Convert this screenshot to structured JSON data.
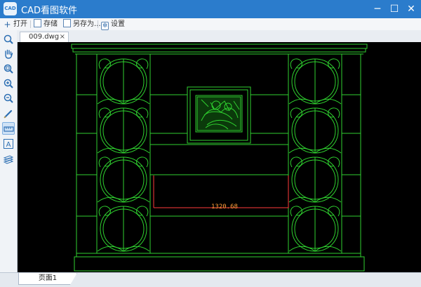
{
  "app": {
    "logo_text": "CAD",
    "title": "CAD看图软件"
  },
  "window_controls": {
    "minimize": "─",
    "maximize": "☐",
    "close": "✕"
  },
  "toolbar": {
    "open_label": "打开",
    "save_label": "存储",
    "save_as_label": "另存为...",
    "settings_label": "设置"
  },
  "tabs": [
    {
      "label": "009.dwg",
      "close": "×"
    }
  ],
  "left_tools": [
    {
      "name": "zoom-window-icon"
    },
    {
      "name": "pan-hand-icon"
    },
    {
      "name": "zoom-extents-icon"
    },
    {
      "name": "zoom-in-icon"
    },
    {
      "name": "zoom-out-icon"
    },
    {
      "name": "pen-icon"
    },
    {
      "name": "measure-icon",
      "active": true
    },
    {
      "name": "text-icon",
      "glyph": "A"
    },
    {
      "name": "layers-icon"
    }
  ],
  "drawing": {
    "dimension_text": "1320.68",
    "line_color": "#2fd12f",
    "dimension_color": "#ff3b3b"
  },
  "bottom": {
    "page_tab": "页面1"
  }
}
